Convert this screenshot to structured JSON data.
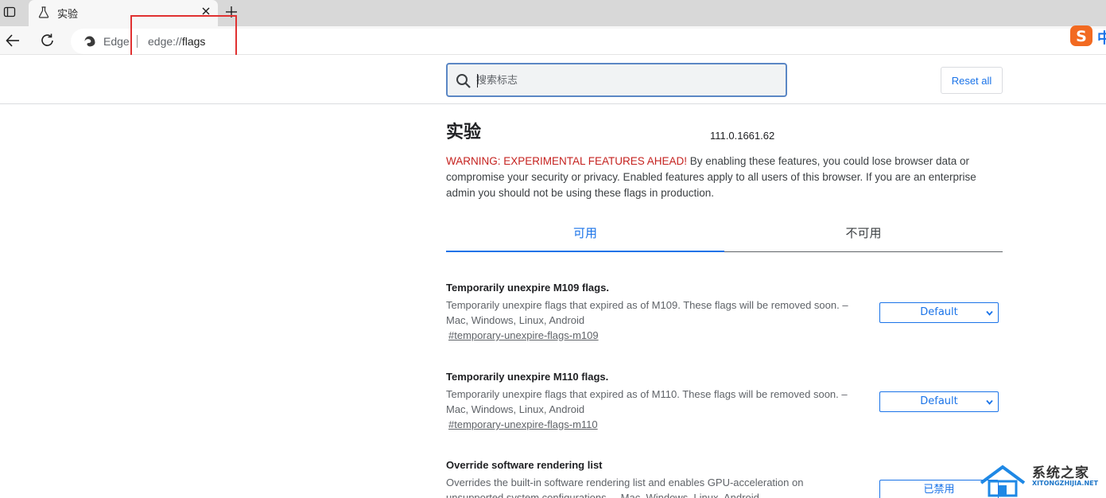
{
  "browser": {
    "tab_title": "实验",
    "site_label": "Edge",
    "url_scheme": "edge://",
    "url_path": "flags",
    "extension_char": "中"
  },
  "header": {
    "search_placeholder": "搜索标志",
    "reset_label": "Reset all"
  },
  "main": {
    "title": "实验",
    "version": "111.0.1661.62",
    "warning_prefix": "WARNING: EXPERIMENTAL FEATURES AHEAD!",
    "warning_text": " By enabling these features, you could lose browser data or compromise your security or privacy. Enabled features apply to all users of this browser. If you are an enterprise admin you should not be using these flags in production.",
    "tabs": [
      {
        "label": "可用",
        "active": true
      },
      {
        "label": "不可用",
        "active": false
      }
    ],
    "experiments": [
      {
        "name": "Temporarily unexpire M109 flags.",
        "description": "Temporarily unexpire flags that expired as of M109. These flags will be removed soon. – Mac, Windows, Linux, Android",
        "link": "#temporary-unexpire-flags-m109",
        "value": "Default"
      },
      {
        "name": "Temporarily unexpire M110 flags.",
        "description": "Temporarily unexpire flags that expired as of M110. These flags will be removed soon. – Mac, Windows, Linux, Android",
        "link": "#temporary-unexpire-flags-m110",
        "value": "Default"
      },
      {
        "name": "Override software rendering list",
        "description": "Overrides the built-in software rendering list and enables GPU-acceleration on unsupported system configurations. – Mac, Windows, Linux, Android",
        "link": "",
        "value": "已禁用"
      }
    ]
  },
  "watermark": {
    "title": "系统之家",
    "url": "XITONGZHIJIA.NET"
  },
  "colors": {
    "accent": "#1a73e8",
    "warning": "#c5221f",
    "highlight": "#e03131"
  }
}
